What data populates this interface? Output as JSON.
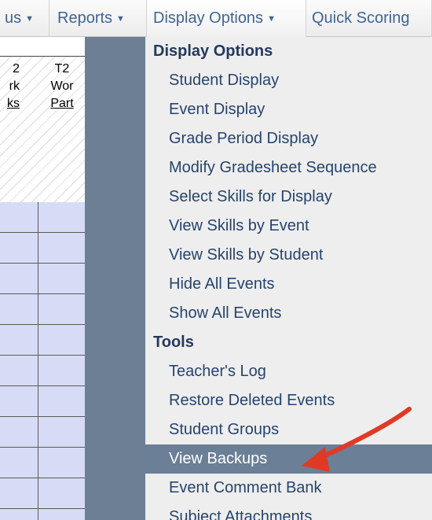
{
  "menubar": {
    "items": [
      {
        "label": "us"
      },
      {
        "label": "Reports"
      },
      {
        "label": "Display Options"
      },
      {
        "label": "Quick Scoring"
      }
    ]
  },
  "grid": {
    "col_a": {
      "line1": "2",
      "line2": "rk",
      "line3": "ks"
    },
    "col_b": {
      "line1": "T2",
      "line2": "Wor",
      "line3": "Part"
    }
  },
  "dropdown": {
    "display_options_title": "Display Options",
    "display_options_items": [
      "Student Display",
      "Event Display",
      "Grade Period Display",
      "Modify Gradesheet Sequence",
      "Select Skills for Display",
      "View Skills by Event",
      "View Skills by Student",
      "Hide All Events",
      "Show All Events"
    ],
    "tools_title": "Tools",
    "tools_items": [
      "Teacher's Log",
      "Restore Deleted Events",
      "Student Groups",
      "View Backups",
      "Event Comment Bank",
      "Subject Attachments"
    ],
    "highlighted_item": "View Backups"
  },
  "colors": {
    "menu_text": "#3f6594",
    "dropdown_bg": "#eeeeee",
    "highlight_bg": "#6b7f96",
    "cell_fill": "#d6dcf6",
    "arrow": "#e03a26"
  },
  "icons": {
    "caret": "caret-down-icon",
    "arrow": "red-arrow-annotation"
  }
}
